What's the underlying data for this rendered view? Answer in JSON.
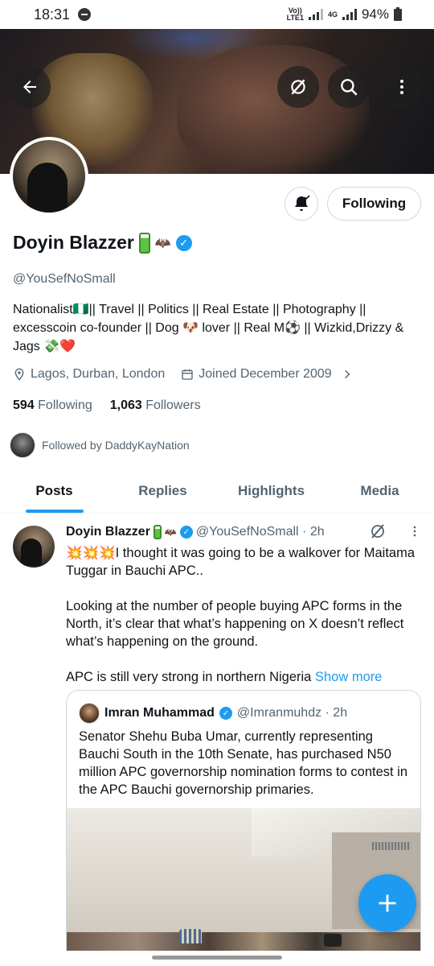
{
  "status_bar": {
    "time": "18:31",
    "network_top": "Vo))",
    "network_bottom": "LTE1",
    "network_type": "4G",
    "battery": "94%"
  },
  "header": {
    "back_icon": "arrow-left-icon",
    "grok_icon": "grok-slash-icon",
    "search_icon": "search-icon",
    "more_icon": "more-vertical-icon"
  },
  "profile": {
    "display_name": "Doyin Blazzer",
    "handle": "@YouSefNoSmall",
    "bio_line1": "Nationalist🇳🇬|| Travel || Politics || Real Estate || Photography ||",
    "bio_line2": "excesscoin co-founder || Dog 🐶 lover || Real M⚽ || Wizkid,Drizzy &",
    "bio_line3": "Jags 💸❤️",
    "location": "Lagos, Durban, London",
    "joined": "Joined December 2009",
    "following_count": "594",
    "following_label": "Following",
    "followers_count": "1,063",
    "followers_label": "Followers",
    "followed_by": "Followed by DaddyKayNation",
    "follow_button": "Following"
  },
  "tabs": [
    {
      "label": "Posts",
      "active": true
    },
    {
      "label": "Replies",
      "active": false
    },
    {
      "label": "Highlights",
      "active": false
    },
    {
      "label": "Media",
      "active": false
    }
  ],
  "post": {
    "author": "Doyin Blazzer",
    "handle_time": "@YouSefNoSmall · 2h",
    "para1": "💥💥💥I thought it was going to be a walkover for Maitama Tuggar in Bauchi APC..",
    "para2": "Looking at the number of people buying APC forms in the North, it’s clear that what’s happening on X doesn’t reflect what’s happening on the ground.",
    "para3": "APC is still very strong in northern Nigeria",
    "show_more": "Show more",
    "quote": {
      "author": "Imran Muhammad",
      "handle_time": "@Imranmuhdz · 2h",
      "text": "Senator Shehu Buba Umar, currently representing Bauchi South in the 10th Senate, has purchased N50 million APC governorship nomination forms to contest in the APC Bauchi governorship primaries."
    }
  },
  "colors": {
    "accent": "#1d9bf0",
    "text": "#0f1419",
    "secondary": "#536471",
    "border": "#cfd9de"
  }
}
